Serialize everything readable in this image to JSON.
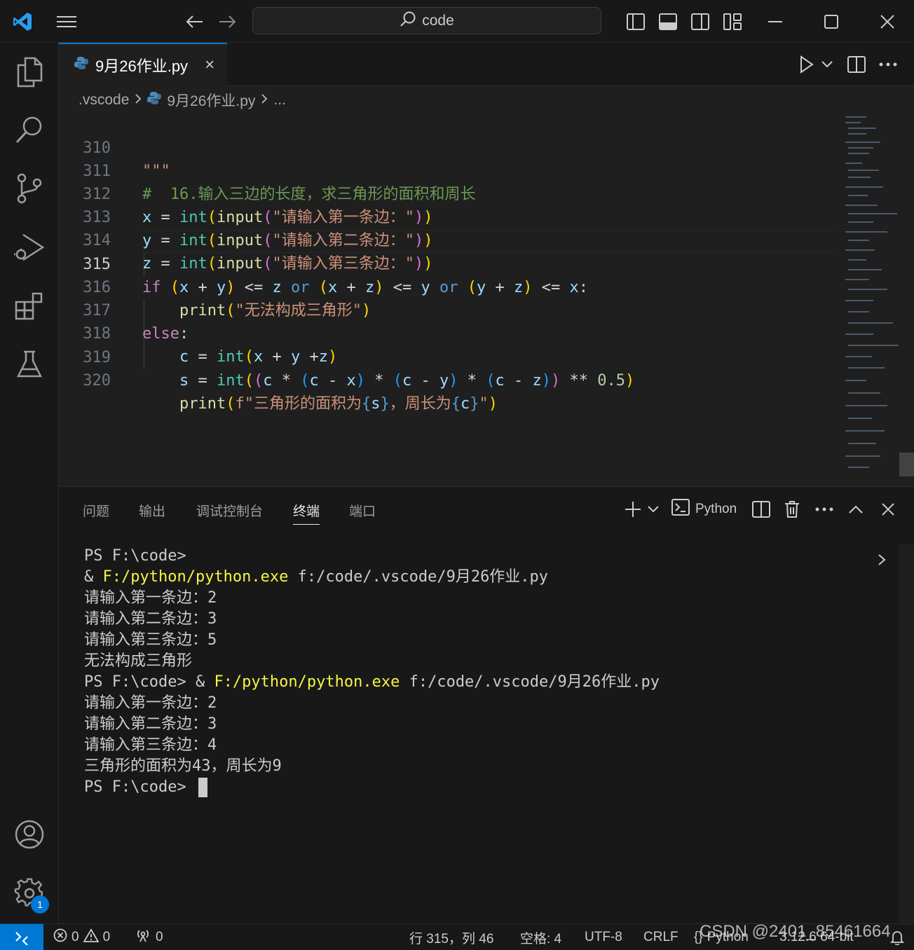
{
  "titlebar": {
    "search_text": "code"
  },
  "tab": {
    "filename": "9月26作业.py",
    "close": "×"
  },
  "breadcrumb": {
    "folder": ".vscode",
    "file": "9月26作业.py",
    "more": "..."
  },
  "editor": {
    "active_line": 315,
    "lines": [
      {
        "n": "310"
      },
      {
        "n": "311"
      },
      {
        "n": "312"
      },
      {
        "n": "313"
      },
      {
        "n": "314"
      },
      {
        "n": "315"
      },
      {
        "n": "316"
      },
      {
        "n": "317"
      },
      {
        "n": "318"
      },
      {
        "n": "319"
      },
      {
        "n": "320"
      }
    ],
    "strings": {
      "docstring_end": "\"\"\"",
      "comment": "#  16.输入三边的长度，求三角形的面积和周长",
      "prompt1": "\"请输入第一条边：\"",
      "prompt2": "\"请输入第二条边：\"",
      "prompt3": "\"请输入第三条边：\"",
      "msg_fail": "\"无法构成三角形\"",
      "fstr_a": "f\"三角形的面积为",
      "fstr_b": "，周长为",
      "fstr_c": "\""
    }
  },
  "panel": {
    "tabs": [
      "问题",
      "输出",
      "调试控制台",
      "终端",
      "端口"
    ],
    "active_tab": "终端",
    "shell_label": "Python",
    "terminal": {
      "l1": "PS F:\\code>",
      "l2_prefix": "& ",
      "l2_exe": "F:/python/python.exe",
      "l2_arg": " f:/code/.vscode/9月26作业.py",
      "l3": "请输入第一条边：2",
      "l4": "请输入第二条边：3",
      "l5": "请输入第三条边：5",
      "l6": "无法构成三角形",
      "l7_prefix": "PS F:\\code> & ",
      "l7_exe": "F:/python/python.exe",
      "l7_arg": " f:/code/.vscode/9月26作业.py",
      "l8": "请输入第一条边：2",
      "l9": "请输入第二条边：3",
      "l10": "请输入第三条边：4",
      "l11": "三角形的面积为43，周长为9",
      "l12": "PS F:\\code>"
    }
  },
  "statusbar": {
    "errors": "0",
    "warnings": "0",
    "ports": "0",
    "position": "行 315，列 46",
    "spaces": "空格: 4",
    "encoding": "UTF-8",
    "eol": "CRLF",
    "language_braces": "{}",
    "language": "Python",
    "interpreter": "3.12.6 64-bit"
  },
  "watermark": "CSDN @2401_85461664",
  "settings_badge": "1",
  "colors": {
    "accent": "#0078d4",
    "background": "#1f1f1f",
    "sidebar": "#181818"
  }
}
